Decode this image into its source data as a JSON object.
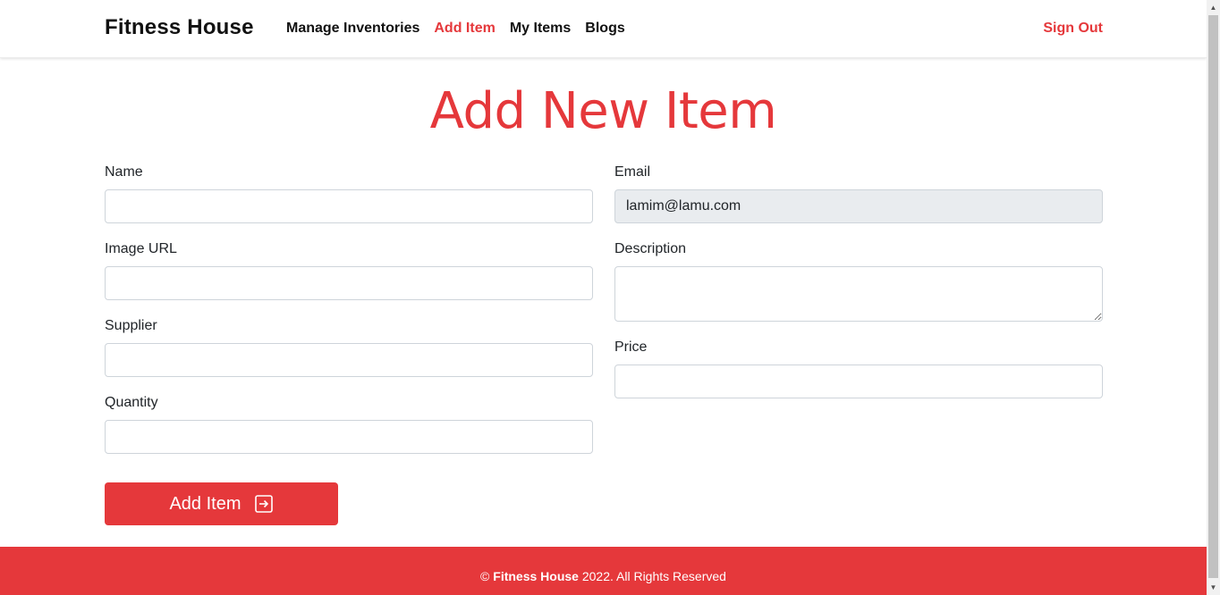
{
  "navbar": {
    "brand": "Fitness House",
    "links": [
      "Manage Inventories",
      "Add Item",
      "My Items",
      "Blogs"
    ],
    "active_index": 1,
    "signout_label": "Sign Out"
  },
  "page": {
    "title": "Add New Item"
  },
  "form": {
    "name": {
      "label": "Name",
      "value": ""
    },
    "image_url": {
      "label": "Image URL",
      "value": ""
    },
    "supplier": {
      "label": "Supplier",
      "value": ""
    },
    "quantity": {
      "label": "Quantity",
      "value": ""
    },
    "email": {
      "label": "Email",
      "value": "lamim@lamu.com"
    },
    "description": {
      "label": "Description",
      "value": ""
    },
    "price": {
      "label": "Price",
      "value": ""
    },
    "submit_label": "Add Item",
    "submit_icon": "box-arrow-in-right-icon"
  },
  "footer": {
    "copyright_symbol": "©",
    "brand": "Fitness House",
    "text": "2022. All Rights Reserved"
  },
  "colors": {
    "accent": "#e5383b",
    "input_border": "#ced4da",
    "disabled_bg": "#e9ecef"
  }
}
